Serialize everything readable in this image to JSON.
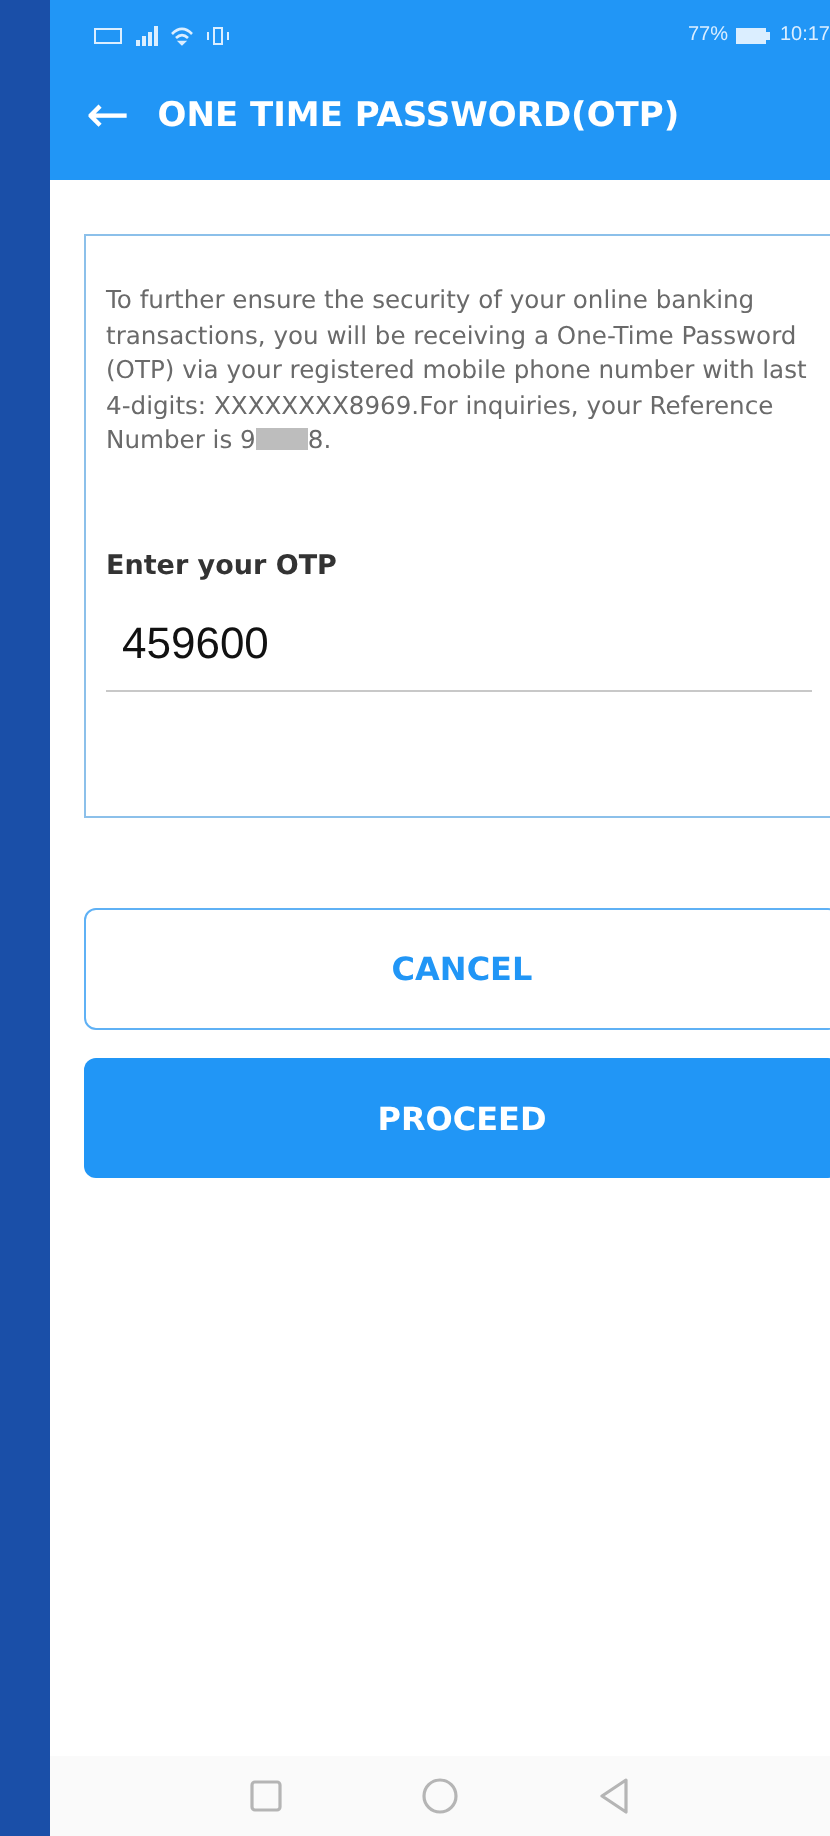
{
  "status_bar": {
    "battery_percent": "77%",
    "time": "10:17"
  },
  "header": {
    "back_icon": "←",
    "title": "ONE TIME PASSWORD(OTP)"
  },
  "card": {
    "message": "To further ensure the security of your online banking transactions, you will be receiving a One-Time Password (OTP) via your registered mobile phone number with last 4-digits: XXXXXXXX8969.For inquiries, your Reference Number is 9",
    "message_end": "8.",
    "otp_label": "Enter your OTP",
    "otp_value": "459600"
  },
  "buttons": [
    {
      "label": "CANCEL",
      "kind": "outline"
    },
    {
      "label": "PROCEED",
      "kind": "filled"
    }
  ]
}
